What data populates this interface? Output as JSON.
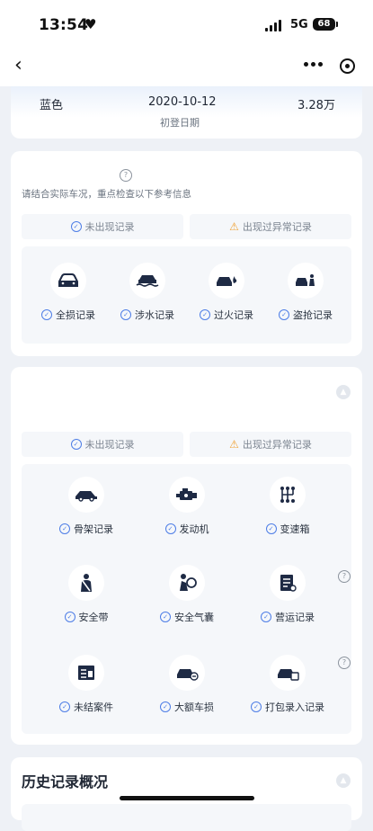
{
  "status": {
    "time": "13:54",
    "network": "5G",
    "battery": "68"
  },
  "info": {
    "color_value": "蓝色",
    "date_value": "2020-10-12",
    "date_label": "初登日期",
    "mileage_value": "3.28万"
  },
  "section1": {
    "note": "请结合实际车况，重点检查以下参考信息",
    "legend_ok": "未出现记录",
    "legend_warn": "出现过异常记录",
    "items": [
      {
        "label": "全损记录",
        "icon": "car-total-loss-icon"
      },
      {
        "label": "涉水记录",
        "icon": "car-flood-icon"
      },
      {
        "label": "过火记录",
        "icon": "car-fire-icon"
      },
      {
        "label": "盗抢记录",
        "icon": "car-theft-icon"
      }
    ]
  },
  "section2": {
    "legend_ok": "未出现记录",
    "legend_warn": "出现过异常记录",
    "items": [
      {
        "label": "骨架记录",
        "icon": "car-frame-icon"
      },
      {
        "label": "发动机",
        "icon": "engine-icon"
      },
      {
        "label": "变速箱",
        "icon": "gearbox-icon"
      },
      {
        "label": "安全带",
        "icon": "seatbelt-icon"
      },
      {
        "label": "安全气囊",
        "icon": "airbag-icon"
      },
      {
        "label": "营运记录",
        "icon": "operation-record-icon"
      },
      {
        "label": "未结案件",
        "icon": "open-case-icon"
      },
      {
        "label": "大额车损",
        "icon": "major-damage-icon"
      },
      {
        "label": "打包录入记录",
        "icon": "bundle-record-icon"
      }
    ]
  },
  "history": {
    "title": "历史记录概况"
  },
  "colors": {
    "accent": "#4d7de6",
    "warning": "#f0a235",
    "icon_dark": "#1e2a44"
  }
}
